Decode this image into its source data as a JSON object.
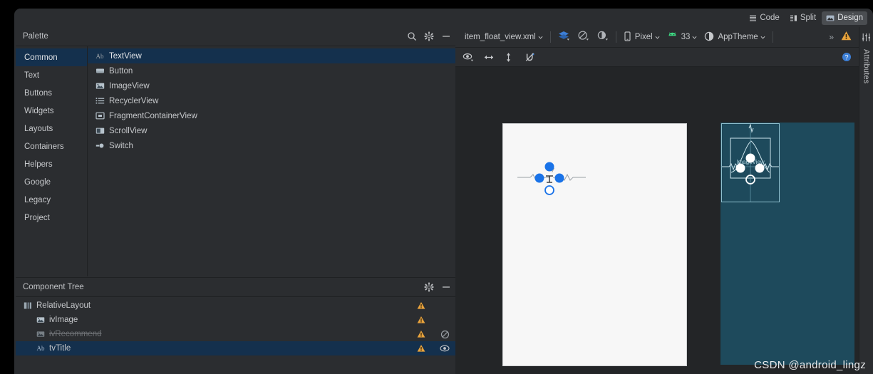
{
  "window": {
    "mode_tabs": [
      {
        "label": "Code",
        "icon": "code-lines-icon",
        "active": false
      },
      {
        "label": "Split",
        "icon": "split-panes-icon",
        "active": false
      },
      {
        "label": "Design",
        "icon": "design-image-icon",
        "active": true
      }
    ]
  },
  "palette": {
    "title": "Palette",
    "icons": [
      {
        "name": "search-icon",
        "glyph": "search"
      },
      {
        "name": "gear-icon",
        "glyph": "gear"
      },
      {
        "name": "minimize-icon",
        "glyph": "minus"
      }
    ],
    "categories": [
      {
        "label": "Common",
        "active": true
      },
      {
        "label": "Text",
        "active": false
      },
      {
        "label": "Buttons",
        "active": false
      },
      {
        "label": "Widgets",
        "active": false
      },
      {
        "label": "Layouts",
        "active": false
      },
      {
        "label": "Containers",
        "active": false
      },
      {
        "label": "Helpers",
        "active": false
      },
      {
        "label": "Google",
        "active": false
      },
      {
        "label": "Legacy",
        "active": false
      },
      {
        "label": "Project",
        "active": false
      }
    ],
    "items": [
      {
        "label": "TextView",
        "icon": "textview-ab-icon",
        "active": true
      },
      {
        "label": "Button",
        "icon": "button-icon",
        "active": false
      },
      {
        "label": "ImageView",
        "icon": "imageview-icon",
        "active": false
      },
      {
        "label": "RecyclerView",
        "icon": "recyclerview-list-icon",
        "active": false
      },
      {
        "label": "FragmentContainerView",
        "icon": "fragment-container-icon",
        "active": false
      },
      {
        "label": "ScrollView",
        "icon": "scrollview-icon",
        "active": false
      },
      {
        "label": "Switch",
        "icon": "switch-icon",
        "active": false
      }
    ]
  },
  "component_tree": {
    "title": "Component Tree",
    "icons": [
      {
        "name": "gear-icon",
        "glyph": "gear"
      },
      {
        "name": "minimize-icon",
        "glyph": "minus"
      }
    ],
    "rows": [
      {
        "label": "RelativeLayout",
        "icon": "relativelayout-icon",
        "indent": 0,
        "selected": false,
        "muted": false,
        "warning": true,
        "visibility_icon": ""
      },
      {
        "label": "ivImage",
        "icon": "imageview-icon",
        "indent": 1,
        "selected": false,
        "muted": false,
        "warning": true,
        "visibility_icon": ""
      },
      {
        "label": "ivRecommend",
        "icon": "imageview-icon",
        "indent": 1,
        "selected": false,
        "muted": true,
        "warning": true,
        "visibility_icon": "not-allowed-icon"
      },
      {
        "label": "tvTitle",
        "icon": "textview-ab-icon",
        "indent": 1,
        "selected": true,
        "muted": false,
        "warning": true,
        "visibility_icon": "eye-icon"
      }
    ]
  },
  "editor_toolbar": {
    "file_name": "item_float_view.xml",
    "design_mode_icon": "layers-icon",
    "orientation_icon": "rotate-device-icon",
    "theme_contrast_icon": "night-mode-icon",
    "device": "Pixel",
    "device_icon": "phone-icon",
    "api_level": "33",
    "api_icon": "android-robot-icon",
    "theme": "AppTheme",
    "theme_icon": "theme-circle-icon",
    "overflow": "»",
    "warning_icon": "warning-triangle-icon"
  },
  "surface_toolbar": {
    "icons": [
      {
        "name": "eye-visibility-icon",
        "glyph": "eye-dropdown"
      },
      {
        "name": "horizontal-resize-icon",
        "glyph": "h-arrow"
      },
      {
        "name": "vertical-resize-icon",
        "glyph": "v-arrow"
      },
      {
        "name": "clear-constraints-magnet-icon",
        "glyph": "magnet-off"
      }
    ],
    "help_icon": "help-question-icon"
  },
  "canvas": {
    "blueprint_label": "ImageView",
    "selection_color": "#1a73e8",
    "blueprint_color": "#1e4a5c",
    "device_color": "#f7f7f7",
    "canvas_color": "#232527"
  },
  "attributes_panel": {
    "label": "Attributes",
    "icon": "sliders-icon"
  },
  "watermark": {
    "text": "CSDN @android_lingz"
  }
}
